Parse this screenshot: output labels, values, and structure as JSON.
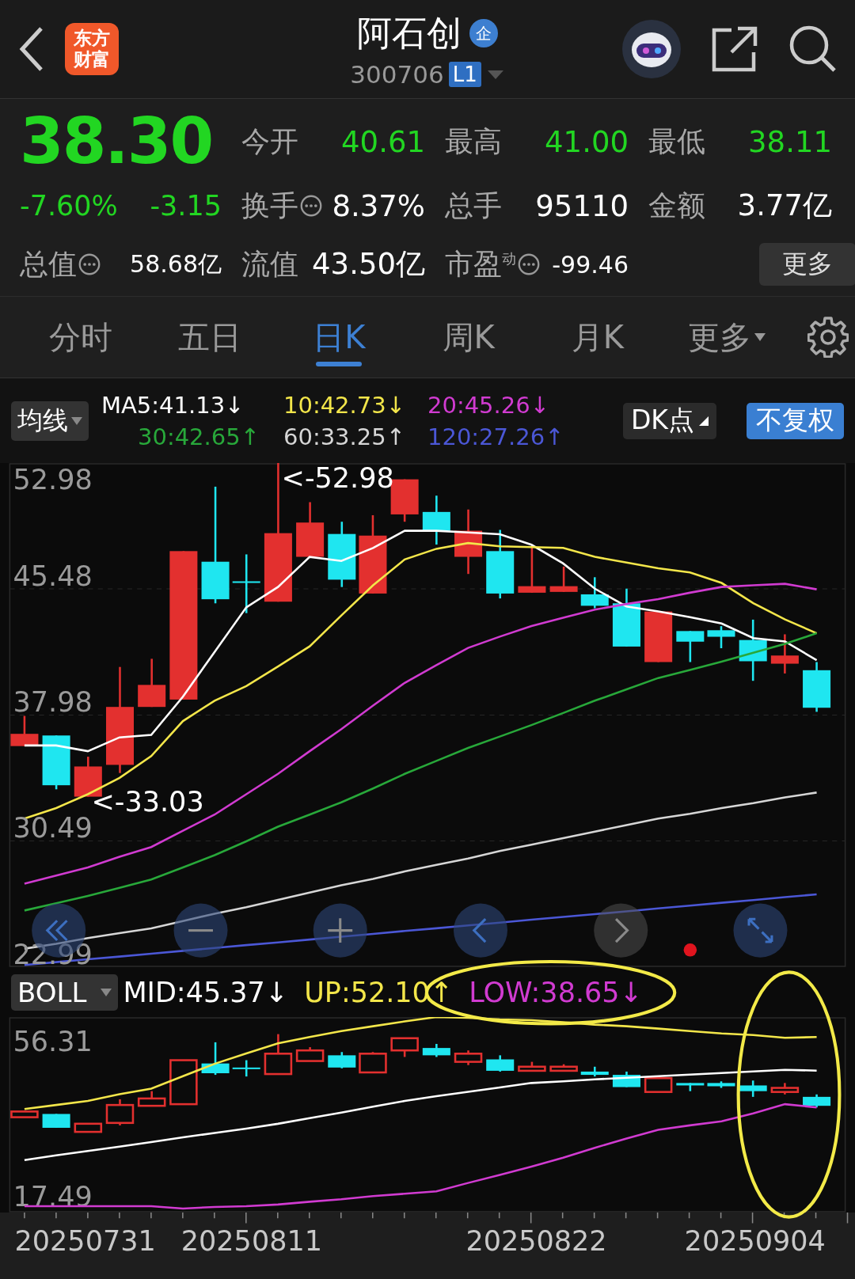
{
  "header": {
    "logo_text": "东方财富",
    "title": "阿石创",
    "title_badge": "企",
    "code": "300706",
    "level_badge": "L1"
  },
  "quote": {
    "price": "38.30",
    "change_pct": "-7.60%",
    "change": "-3.15",
    "rows": [
      [
        {
          "label": "今开",
          "value": "40.61",
          "color": "#22d622"
        },
        {
          "label": "最高",
          "value": "41.00",
          "color": "#22d622"
        },
        {
          "label": "最低",
          "value": "38.11",
          "color": "#22d622"
        }
      ],
      [
        {
          "label": "换手",
          "value": "8.37%",
          "color": "#ffffff",
          "info": true
        },
        {
          "label": "总手",
          "value": "95110",
          "color": "#ffffff"
        },
        {
          "label": "金额",
          "value": "3.77亿",
          "color": "#ffffff"
        }
      ],
      [
        {
          "label": "流值",
          "value": "43.50亿",
          "color": "#ffffff"
        },
        {
          "label": "市盈$^{动}$",
          "value": "-99.46",
          "color": "#ffffff",
          "info": true
        }
      ]
    ],
    "total_value": {
      "label": "总值",
      "value": "58.68亿",
      "info": true
    },
    "more_button": "更多"
  },
  "tabs": [
    {
      "label": "分时",
      "selected": false,
      "kind": "plain"
    },
    {
      "label": "五日",
      "selected": false,
      "kind": "plain"
    },
    {
      "label": "日K",
      "selected": true,
      "kind": "plain"
    },
    {
      "label": "周K",
      "selected": false,
      "kind": "plain"
    },
    {
      "label": "月K",
      "selected": false,
      "kind": "plain"
    },
    {
      "label": "更多",
      "selected": false,
      "kind": "dropdown"
    }
  ],
  "chart": {
    "indicator_button": "均线",
    "ma_legend": [
      {
        "text": "MA5:41.13↓",
        "color": "#ffffff"
      },
      {
        "text": "10:42.73↓",
        "color": "#f3e64a"
      },
      {
        "text": "20:45.26↓",
        "color": "#d13bd1"
      },
      {
        "text": "30:42.65↑",
        "color": "#28a83a"
      },
      {
        "text": "60:33.25↑",
        "color": "#d6d6d6"
      },
      {
        "text": "120:27.26↑",
        "color": "#4b57d6"
      }
    ],
    "dk_button": "DK点",
    "adjust_button": "不复权",
    "main_chart": {
      "max_label": "52.98",
      "annotations": [
        "<-52.98",
        "<-33.03"
      ],
      "chart_data": {
        "type": "line",
        "ylim": [
          22.99,
          52.96
        ],
        "yticks": [
          45.48,
          37.98,
          30.49,
          22.99
        ],
        "grid": true,
        "series": [
          {
            "color": "#ffffff",
            "values": [
              36.17,
              36.17,
              35.83,
              36.65,
              36.8,
              39.07,
              41.73,
              44.38,
              45.59,
              47.38,
              47.14,
              47.91,
              48.93,
              48.93,
              48.83,
              48.73,
              48.1,
              46.99,
              45.49,
              44.43,
              44.14,
              43.8,
              43.42,
              42.55,
              42.35,
              41.24
            ]
          },
          {
            "color": "#f3e64a",
            "values": [
              31.82,
              32.45,
              33.27,
              34.24,
              35.54,
              37.62,
              38.83,
              39.7,
              40.86,
              42.06,
              43.9,
              45.69,
              47.23,
              47.86,
              48.2,
              48.01,
              47.96,
              47.91,
              47.38,
              47.04,
              46.7,
              46.46,
              45.83,
              44.63,
              43.66,
              42.84
            ]
          },
          {
            "color": "#d13bd1",
            "values": [
              27.95,
              28.44,
              28.92,
              29.55,
              30.13,
              31.1,
              32.06,
              33.27,
              34.48,
              35.83,
              37.14,
              38.54,
              39.89,
              40.95,
              41.97,
              42.64,
              43.27,
              43.76,
              44.24,
              44.58,
              44.87,
              45.25,
              45.59,
              45.69,
              45.78,
              45.45
            ]
          },
          {
            "color": "#28a83a",
            "values": [
              26.36,
              26.79,
              27.23,
              27.71,
              28.2,
              28.92,
              29.65,
              30.47,
              31.34,
              32.06,
              32.79,
              33.61,
              34.48,
              35.25,
              36.02,
              36.7,
              37.38,
              38.1,
              38.83,
              39.5,
              40.18,
              40.66,
              41.15,
              41.68,
              42.21,
              42.84
            ]
          },
          {
            "color": "#d6d6d6",
            "values": [
              24.09,
              24.38,
              24.72,
              25.01,
              25.3,
              25.73,
              26.17,
              26.55,
              26.99,
              27.42,
              27.86,
              28.24,
              28.68,
              29.07,
              29.45,
              29.89,
              30.27,
              30.66,
              31.05,
              31.43,
              31.82,
              32.11,
              32.45,
              32.74,
              33.08,
              33.37
            ]
          },
          {
            "color": "#4b57d6",
            "values": [
              23.12,
              23.29,
              23.46,
              23.62,
              23.79,
              23.96,
              24.13,
              24.3,
              24.46,
              24.63,
              24.8,
              24.97,
              25.14,
              25.3,
              25.47,
              25.64,
              25.81,
              25.98,
              26.14,
              26.31,
              26.48,
              26.65,
              26.82,
              26.98,
              27.15,
              27.32
            ]
          }
        ]
      }
    },
    "sub_indicator_button": "BOLL",
    "boll_legend": [
      {
        "text": "MID:45.37↓",
        "color": "#ffffff"
      },
      {
        "text": "UP:52.10↑",
        "color": "#f3e64a"
      },
      {
        "text": "LOW:38.65↓",
        "color": "#d13bd1"
      }
    ],
    "boll_chart": {
      "chart_data": {
        "type": "line",
        "ylim": [
          13.4,
          62.3
        ],
        "yticks": [
          56.31,
          17.49
        ],
        "series": [
          {
            "color": "#ffffff",
            "values": [
              26.5,
              27.7,
              28.8,
              29.9,
              31.0,
              32.2,
              33.3,
              34.4,
              35.6,
              37.0,
              38.4,
              39.9,
              41.3,
              42.5,
              43.6,
              44.7,
              45.8,
              46.2,
              46.7,
              47.1,
              47.5,
              47.9,
              48.3,
              48.7,
              49.1,
              48.9
            ]
          },
          {
            "color": "#f3e64a",
            "values": [
              39.3,
              40.3,
              41.3,
              43.0,
              44.4,
              47.5,
              50.6,
              53.2,
              55.7,
              57.3,
              58.8,
              60.0,
              61.2,
              62.3,
              62.1,
              61.7,
              61.5,
              61.0,
              60.4,
              60.0,
              59.4,
              58.8,
              58.2,
              57.8,
              57.1,
              57.3
            ]
          },
          {
            "color": "#d13bd1",
            "values": [
              15.0,
              15.0,
              15.0,
              15.0,
              15.0,
              14.4,
              14.8,
              15.0,
              15.4,
              16.1,
              16.7,
              17.5,
              18.1,
              18.7,
              20.8,
              22.8,
              24.9,
              27.1,
              29.6,
              31.9,
              34.1,
              35.2,
              36.2,
              38.2,
              40.5,
              39.7
            ]
          }
        ]
      }
    },
    "dates": [
      "20250731",
      "20250811",
      "20250822",
      "20250904"
    ]
  }
}
